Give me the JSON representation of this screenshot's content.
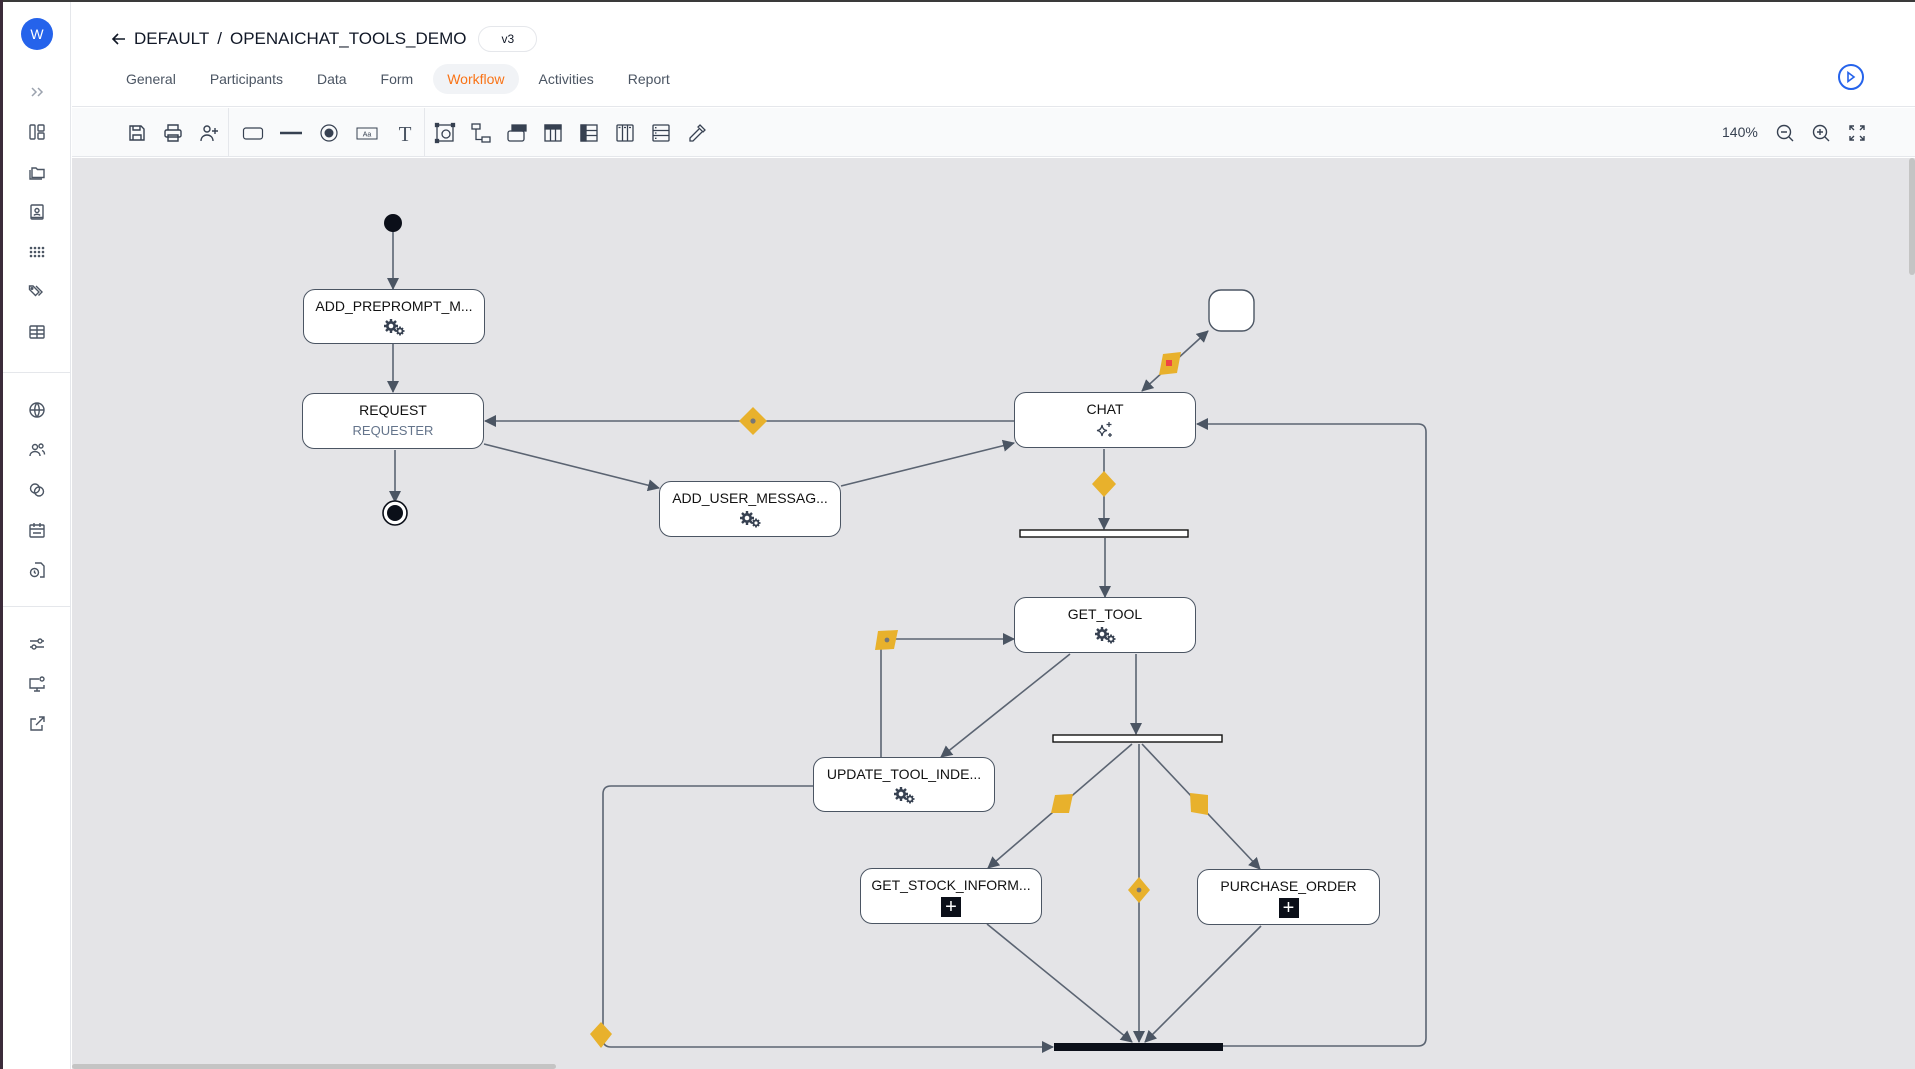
{
  "user": {
    "avatar_initial": "W"
  },
  "sidebar": {
    "expand_icon": "chevrons-right-icon",
    "groups": [
      [
        {
          "icon": "dashboard-icon",
          "label": "Dashboard"
        },
        {
          "icon": "folders-icon",
          "label": "Folders"
        },
        {
          "icon": "contact-book-icon",
          "label": "Contacts"
        },
        {
          "icon": "apps-grid-icon",
          "label": "Apps"
        },
        {
          "icon": "tags-icon",
          "label": "Tags"
        },
        {
          "icon": "table-icon",
          "label": "Tables"
        }
      ],
      [
        {
          "icon": "globe-icon",
          "label": "Global"
        },
        {
          "icon": "users-icon",
          "label": "Users"
        },
        {
          "icon": "circles-icon",
          "label": "Groups"
        },
        {
          "icon": "calendar-icon",
          "label": "Calendar"
        },
        {
          "icon": "file-clock-icon",
          "label": "History"
        }
      ],
      [
        {
          "icon": "sliders-icon",
          "label": "Settings"
        },
        {
          "icon": "monitor-settings-icon",
          "label": "Display"
        },
        {
          "icon": "external-link-icon",
          "label": "Open"
        }
      ]
    ]
  },
  "header": {
    "breadcrumb": {
      "parent": "DEFAULT",
      "separator": "/",
      "current": "OPENAICHAT_TOOLS_DEMO"
    },
    "version": "v3",
    "tabs": [
      {
        "label": "General",
        "active": false
      },
      {
        "label": "Participants",
        "active": false
      },
      {
        "label": "Data",
        "active": false
      },
      {
        "label": "Form",
        "active": false
      },
      {
        "label": "Workflow",
        "active": true
      },
      {
        "label": "Activities",
        "active": false
      },
      {
        "label": "Report",
        "active": false
      }
    ],
    "run_icon": "play-circle-icon",
    "accent_color": "#f97316",
    "primary_color": "#2563eb"
  },
  "toolbar": {
    "tools": [
      {
        "icon": "save-icon",
        "label": "Save"
      },
      {
        "icon": "print-icon",
        "label": "Print"
      },
      {
        "icon": "add-participant-icon",
        "label": "Add participant"
      },
      {
        "icon": "activity-shape-icon",
        "label": "Activity"
      },
      {
        "icon": "line-icon",
        "label": "Transition"
      },
      {
        "icon": "end-event-icon",
        "label": "End"
      },
      {
        "icon": "label-icon",
        "label": "Label"
      },
      {
        "icon": "text-icon",
        "label": "Text"
      },
      {
        "icon": "select-shape-icon",
        "label": "Select"
      },
      {
        "icon": "flowchart-icon",
        "label": "Layout"
      },
      {
        "icon": "lane-header-icon",
        "label": "Lane"
      },
      {
        "icon": "columns-header-icon",
        "label": "Columns"
      },
      {
        "icon": "rows-header-icon",
        "label": "Rows"
      },
      {
        "icon": "vertical-lanes-icon",
        "label": "Vertical lanes"
      },
      {
        "icon": "horizontal-lanes-icon",
        "label": "Horizontal lanes"
      },
      {
        "icon": "eyedropper-icon",
        "label": "Pick"
      }
    ],
    "zoom_level": "140%",
    "zoom_out_icon": "zoom-out-icon",
    "zoom_in_icon": "zoom-in-icon",
    "fit_icon": "fit-screen-icon"
  },
  "diagram": {
    "nodes": [
      {
        "id": "add_preprompt",
        "title": "ADD_PREPROMPT_M...",
        "icon": "gears-icon"
      },
      {
        "id": "request",
        "title": "REQUEST",
        "subtitle": "REQUESTER"
      },
      {
        "id": "add_user_message",
        "title": "ADD_USER_MESSAG...",
        "icon": "gears-icon"
      },
      {
        "id": "chat",
        "title": "CHAT",
        "icon": "sparkles-icon"
      },
      {
        "id": "get_tool",
        "title": "GET_TOOL",
        "icon": "gears-icon"
      },
      {
        "id": "update_tool_index",
        "title": "UPDATE_TOOL_INDE...",
        "icon": "gears-icon"
      },
      {
        "id": "get_stock_information",
        "title": "GET_STOCK_INFORM...",
        "icon": "subprocess-plus-icon"
      },
      {
        "id": "purchase_order",
        "title": "PURCHASE_ORDER",
        "icon": "subprocess-plus-icon"
      }
    ],
    "plus_glyph": "+",
    "colors": {
      "condition": "#e8b12c",
      "edge": "#4b5563",
      "error_marker": "#ef4444"
    }
  }
}
